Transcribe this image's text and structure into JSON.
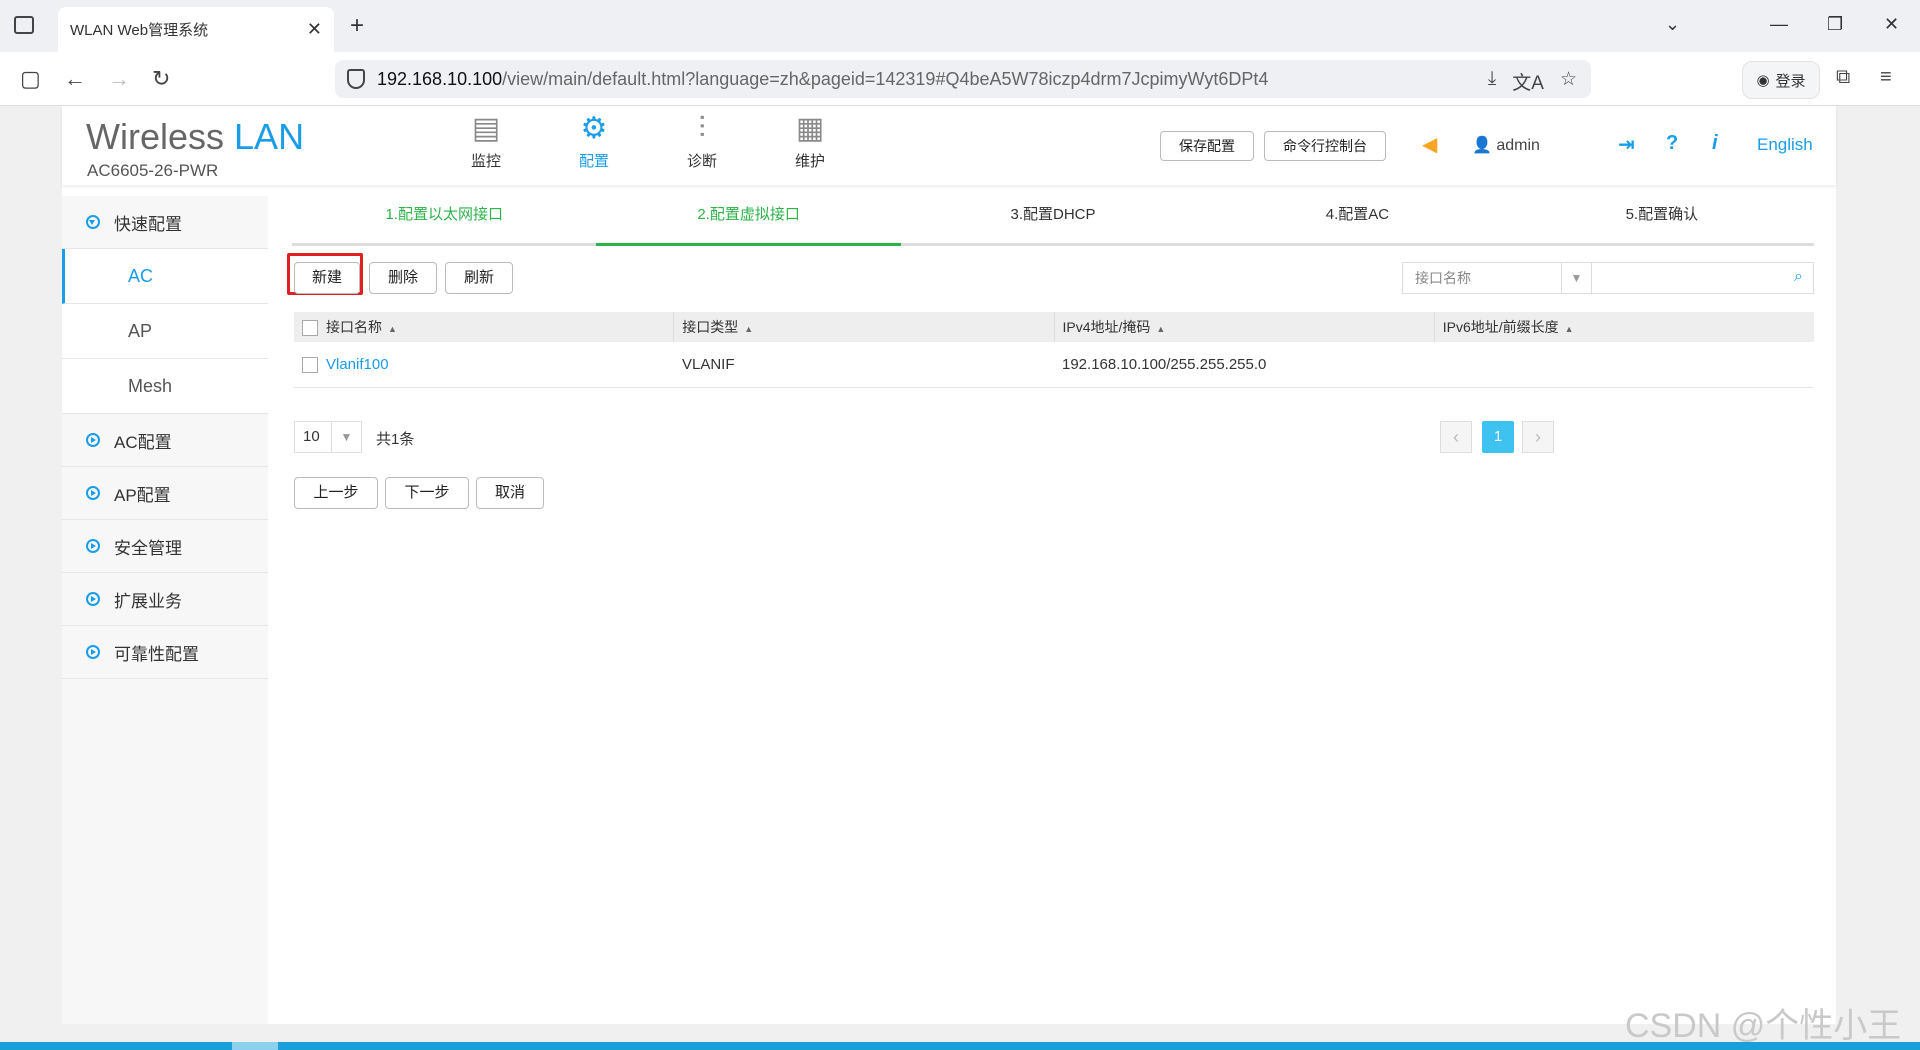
{
  "browser": {
    "tab_title": "WLAN Web管理系统",
    "url_host": "192.168.10.100",
    "url_path": "/view/main/default.html?language=zh&pageid=142319#Q4beA5W78iczp4drm7JcpimyWyt6DPt4",
    "login_label": "登录"
  },
  "header": {
    "logo_main": "Wireless",
    "logo_accent": "LAN",
    "model": "AC6605-26-PWR",
    "nav": [
      {
        "label": "监控",
        "icon": "monitor-icon"
      },
      {
        "label": "配置",
        "icon": "gear-icon"
      },
      {
        "label": "诊断",
        "icon": "sliders-icon"
      },
      {
        "label": "维护",
        "icon": "maintenance-icon"
      }
    ],
    "save_label": "保存配置",
    "console_label": "命令行控制台",
    "user": "admin",
    "language": "English"
  },
  "sidebar": {
    "quick": "快速配置",
    "subs": [
      "AC",
      "AP",
      "Mesh"
    ],
    "groups": [
      "AC配置",
      "AP配置",
      "安全管理",
      "扩展业务",
      "可靠性配置"
    ]
  },
  "steps": [
    "1.配置以太网接口",
    "2.配置虚拟接口",
    "3.配置DHCP",
    "4.配置AC",
    "5.配置确认"
  ],
  "toolbar": {
    "new": "新建",
    "delete": "删除",
    "refresh": "刷新",
    "search_field": "接口名称",
    "search_value": ""
  },
  "table": {
    "headers": [
      "接口名称",
      "接口类型",
      "IPv4地址/掩码",
      "IPv6地址/前缀长度"
    ],
    "rows": [
      {
        "name": "Vlanif100",
        "type": "VLANIF",
        "ipv4": "192.168.10.100/255.255.255.0",
        "ipv6": ""
      }
    ]
  },
  "pager": {
    "page_size": "10",
    "total": "共1条",
    "current": "1"
  },
  "footer_buttons": {
    "prev": "上一步",
    "next": "下一步",
    "cancel": "取消"
  },
  "watermark": "CSDN @个性小王",
  "colors": {
    "accent": "#1a9de8",
    "step_done": "#2db34a",
    "highlight": "#e02020"
  }
}
